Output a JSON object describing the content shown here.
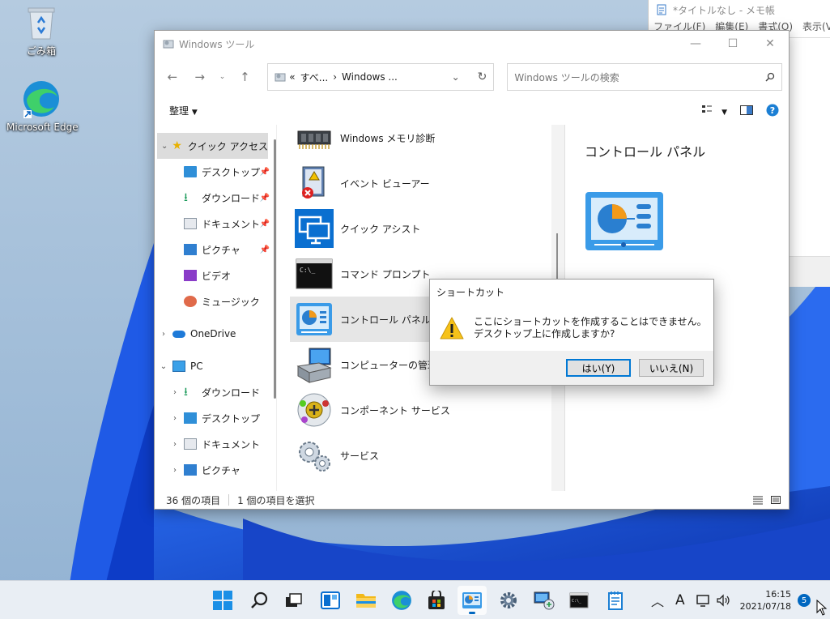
{
  "desktop": {
    "icons": [
      {
        "label": "ごみ箱",
        "icon": "recycle-bin-icon"
      },
      {
        "label": "Microsoft Edge",
        "icon": "edge-icon"
      }
    ]
  },
  "notepad": {
    "title": "*タイトルなし - メモ帳",
    "menu": [
      "ファイル(F)",
      "編集(E)",
      "書式(O)",
      "表示(V)"
    ]
  },
  "explorer": {
    "title": "Windows ツール",
    "address": {
      "prefix": "«",
      "crumbs": [
        "すべ...",
        "Windows ..."
      ]
    },
    "search_placeholder": "Windows ツールの検索",
    "organize_label": "整理",
    "nav": {
      "quick_access": "クイック アクセス",
      "quick_items": [
        "デスクトップ",
        "ダウンロード",
        "ドキュメント",
        "ピクチャ",
        "ビデオ",
        "ミュージック"
      ],
      "onedrive": "OneDrive",
      "pc": "PC",
      "pc_items": [
        "ダウンロード",
        "デスクトップ",
        "ドキュメント",
        "ピクチャ"
      ]
    },
    "files": [
      {
        "label": "Windows メモリ診断",
        "icon": "memory-diagnostic-icon"
      },
      {
        "label": "イベント ビューアー",
        "icon": "event-viewer-icon"
      },
      {
        "label": "クイック アシスト",
        "icon": "quick-assist-icon"
      },
      {
        "label": "コマンド プロンプト",
        "icon": "command-prompt-icon"
      },
      {
        "label": "コントロール パネル",
        "icon": "control-panel-icon"
      },
      {
        "label": "コンピューターの管理",
        "icon": "computer-management-icon"
      },
      {
        "label": "コンポーネント サービス",
        "icon": "component-services-icon"
      },
      {
        "label": "サービス",
        "icon": "services-icon"
      }
    ],
    "preview_title": "コントロール パネル",
    "status": {
      "count": "36 個の項目",
      "selected": "1 個の項目を選択"
    }
  },
  "dialog": {
    "title": "ショートカット",
    "message_line1": "ここにショートカットを作成することはできません。",
    "message_line2": "デスクトップ上に作成しますか?",
    "yes_label": "はい(Y)",
    "no_label": "いいえ(N)"
  },
  "taskbar": {
    "time": "16:15",
    "date": "2021/07/18",
    "notifications": "5",
    "ime": "A"
  },
  "colors": {
    "accent": "#0078d4",
    "taskbar_bg": "#e9eef4"
  }
}
